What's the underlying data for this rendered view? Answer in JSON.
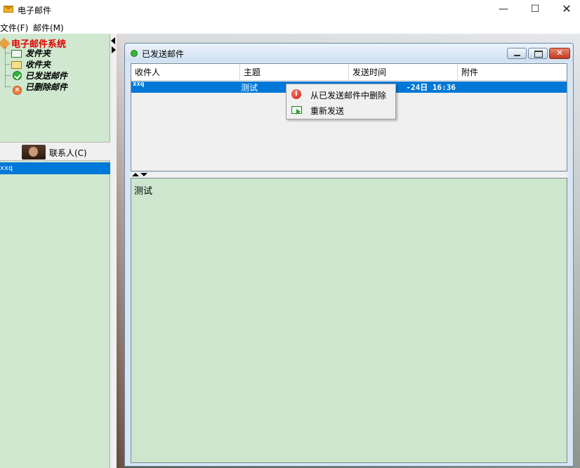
{
  "window": {
    "title": "电子邮件",
    "minimize_icon": "minimize-icon",
    "maximize_icon": "maximize-icon",
    "close_icon": "close-icon"
  },
  "menu": {
    "file": "文件(F)",
    "mail": "邮件(M)"
  },
  "tree": {
    "root": "电子邮件系统",
    "items": [
      {
        "label": "发件夹",
        "icon": "outbox-icon"
      },
      {
        "label": "收件夹",
        "icon": "inbox-folder-icon"
      },
      {
        "label": "已发送邮件",
        "icon": "sent-check-icon"
      },
      {
        "label": "已删除邮件",
        "icon": "deleted-x-icon"
      }
    ]
  },
  "contacts": {
    "header": "联系人(C)",
    "items": [
      "xxq"
    ]
  },
  "frame": {
    "title": "已发送邮件",
    "close_glyph": "✕"
  },
  "table": {
    "columns": [
      "收件人",
      "主题",
      "发送时间",
      "附件"
    ],
    "rows": [
      {
        "recipient": "xxq",
        "subject": "测试",
        "time": "24日 16:36-",
        "attachment": ""
      }
    ]
  },
  "body": {
    "text": "测试"
  },
  "context_menu": {
    "items": [
      "从已发送邮件中删除",
      "重新发送"
    ]
  },
  "colors": {
    "selection": "#0078d7",
    "panel_green": "#cfe8cf",
    "tree_root_red": "#e00000"
  }
}
